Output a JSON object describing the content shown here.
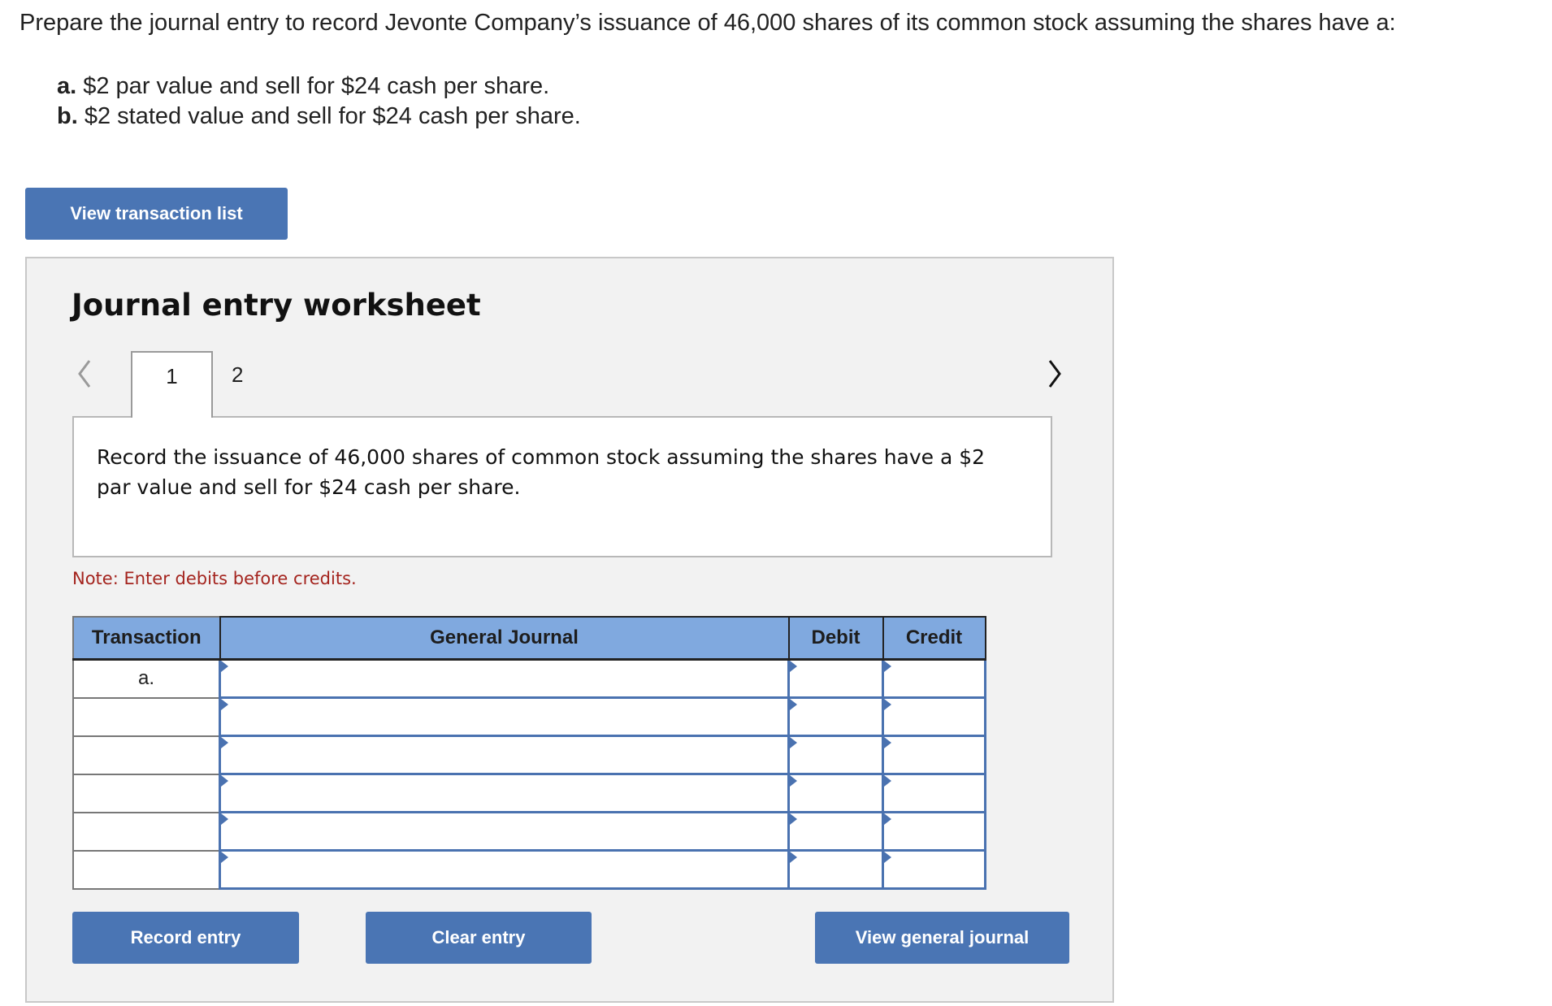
{
  "question": {
    "prompt": "Prepare the journal entry to record Jevonte Company’s issuance of 46,000 shares of its common stock assuming the shares have a:",
    "items": [
      {
        "label": "a.",
        "text": " $2 par value and sell for $24 cash per share."
      },
      {
        "label": "b.",
        "text": " $2 stated value and sell for $24 cash per share."
      }
    ]
  },
  "buttons": {
    "view_transaction_list": "View transaction list",
    "record_entry": "Record entry",
    "clear_entry": "Clear entry",
    "view_general_journal": "View general journal"
  },
  "worksheet": {
    "title": "Journal entry worksheet",
    "prev_icon": "chevron-left-icon",
    "next_icon": "chevron-right-icon",
    "tabs": [
      {
        "label": "1",
        "active": true
      },
      {
        "label": "2",
        "active": false
      }
    ],
    "instruction": "Record the issuance of 46,000 shares of common stock assuming the shares have a $2 par value and sell for $24 cash per share.",
    "note": "Note: Enter debits before credits."
  },
  "table": {
    "headers": [
      "Transaction",
      "General Journal",
      "Debit",
      "Credit"
    ],
    "rows": [
      {
        "transaction": "a.",
        "account": "",
        "debit": "",
        "credit": ""
      },
      {
        "transaction": "",
        "account": "",
        "debit": "",
        "credit": ""
      },
      {
        "transaction": "",
        "account": "",
        "debit": "",
        "credit": ""
      },
      {
        "transaction": "",
        "account": "",
        "debit": "",
        "credit": ""
      },
      {
        "transaction": "",
        "account": "",
        "debit": "",
        "credit": ""
      },
      {
        "transaction": "",
        "account": "",
        "debit": "",
        "credit": ""
      }
    ]
  },
  "colors": {
    "button": "#4a75b4",
    "header": "#80a9df",
    "note": "#a4241e",
    "panel": "#f2f2f2"
  }
}
